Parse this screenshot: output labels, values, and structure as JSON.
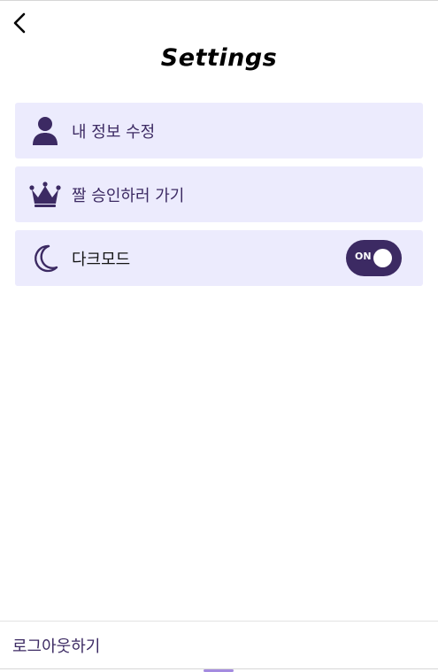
{
  "header": {
    "back_icon": "chevron-left-icon",
    "title": "Settings"
  },
  "settings": {
    "items": [
      {
        "label": "내 정보 수정",
        "icon": "user-icon"
      },
      {
        "label": "짤 승인하러 가기",
        "icon": "crown-icon"
      },
      {
        "label": "다크모드",
        "icon": "moon-icon"
      }
    ],
    "dark_mode_toggle": {
      "text": "ON",
      "state": "on"
    }
  },
  "footer": {
    "logout_label": "로그아웃하기"
  },
  "colors": {
    "accent": "#3c2a63",
    "item_background": "#ecebfd",
    "background": "#ffffff"
  }
}
